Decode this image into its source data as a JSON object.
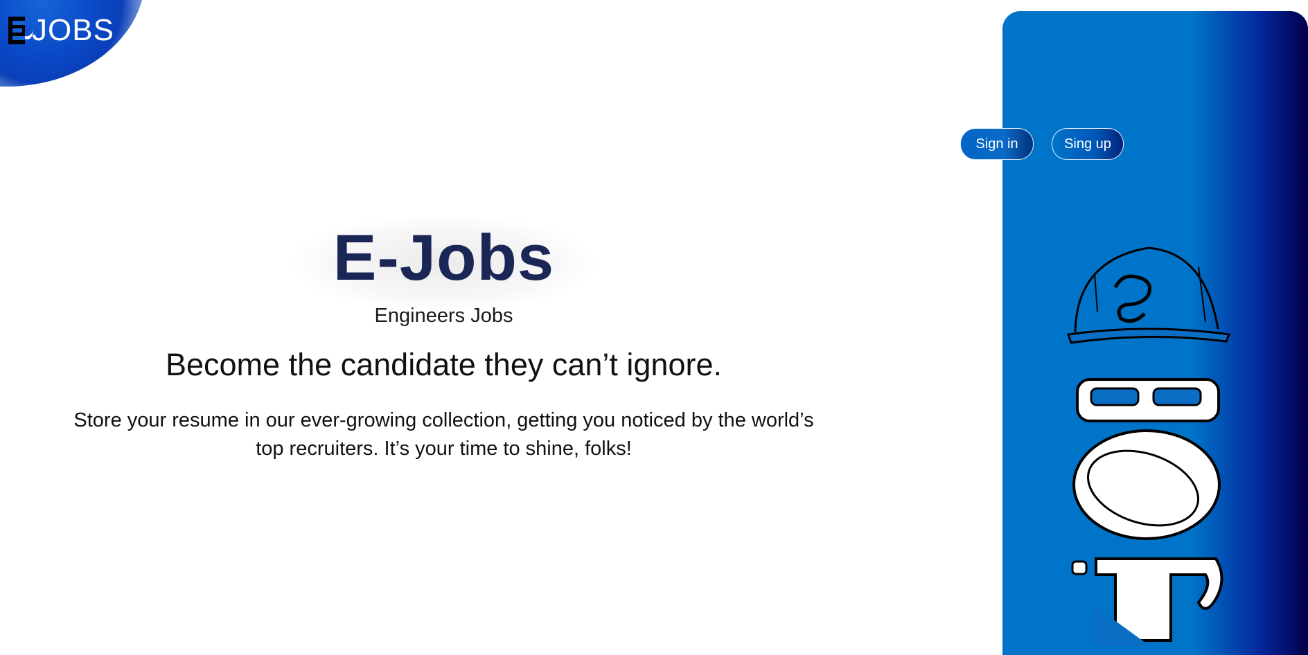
{
  "brand": {
    "logo_text": "JOBS",
    "logo_letter": "E"
  },
  "nav": {
    "signin_label": "Sign in",
    "signup_label": "Sing up"
  },
  "hero": {
    "title": "E-Jobs",
    "subtitle": "Engineers Jobs",
    "tagline": "Become the candidate they can’t ignore.",
    "description": "Store your resume in our ever-growing collection, getting you noticed by the world’s top recruiters. It’s your time to shine, folks!"
  },
  "colors": {
    "primary_blue": "#0074c8",
    "dark_navy": "#00004a",
    "title_navy": "#1a2656",
    "white": "#ffffff"
  },
  "illustration": {
    "name": "hard-hat-jobs-vertical-lettering"
  }
}
